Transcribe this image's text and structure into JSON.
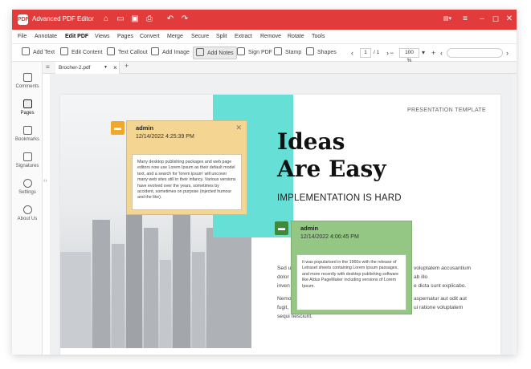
{
  "app": {
    "title": "Advanced PDF Editor",
    "logo_text": "PDF",
    "accent": "#e13b3b"
  },
  "titlebar_icons": [
    "home-icon",
    "folder-icon",
    "save-icon",
    "print-icon",
    "undo-icon",
    "redo-icon",
    "flag-icon",
    "menu-icon",
    "minimize-icon",
    "maximize-icon",
    "close-icon"
  ],
  "menu": [
    "File",
    "Annotate",
    "Edit PDF",
    "Views",
    "Pages",
    "Convert",
    "Merge",
    "Secure",
    "Split",
    "Extract",
    "Remove",
    "Rotate",
    "Tools"
  ],
  "active_menu": "Edit PDF",
  "toolbar": {
    "add_text": "Add Text",
    "edit_content": "Edit Content",
    "text_callout": "Text Callout",
    "add_image": "Add Image",
    "add_notes": "Add Notes",
    "sign_pdf": "Sign PDF",
    "stamp": "Stamp",
    "shapes": "Shapes",
    "page_current": "1",
    "page_total": "/ 1",
    "zoom": "100 %",
    "zoom_out": "−",
    "zoom_in": "+"
  },
  "sidebar": [
    "Comments",
    "Pages",
    "Bookmarks",
    "Signatures",
    "Settings",
    "About Us"
  ],
  "tab": {
    "label": "Brocher-2.pdf",
    "close": "×"
  },
  "document": {
    "presentation": "PRESENTATION TEMPLATE",
    "headline_1": "Ideas",
    "headline_2": "Are Easy",
    "subtitle": "IMPLEMENTATION IS HARD",
    "para_1a": "Sed u",
    "para_1b": "voluptatem accusantium",
    "para_2a": "dolor",
    "para_2b": "ab illo",
    "para_3a": "inven",
    "para_3b": "e dicta sunt explicabo.",
    "para_4a": "Nemo",
    "para_4b": "aspernatur aut odit aut",
    "para_5a": "fugit,",
    "para_5b": "ui ratione voluptatem",
    "para_6": "sequi nesciunt."
  },
  "notes": [
    {
      "author": "admin",
      "date": "12/14/2022 4:25:39 PM",
      "color": "#f4d592",
      "icon_color": "#f0a82b",
      "text": "Many desktop publishing packages and web page editors now use Lorem Ipsum as their default model text, and a search for 'lorem ipsum' will uncover many web sites still in their infancy. Various versions have evolved over the years, sometimes by accident, sometimes on purpose (injected humour and the like)."
    },
    {
      "author": "admin",
      "date": "12/14/2022 4:06:45 PM",
      "color": "#94c784",
      "icon_color": "#3c8a3a",
      "text": "It was popularised in the 1960s with the release of Letraset sheets containing Lorem Ipsum passages, and more recently with desktop publishing software like Aldus PageMaker including versions of Lorem Ipsum."
    }
  ]
}
